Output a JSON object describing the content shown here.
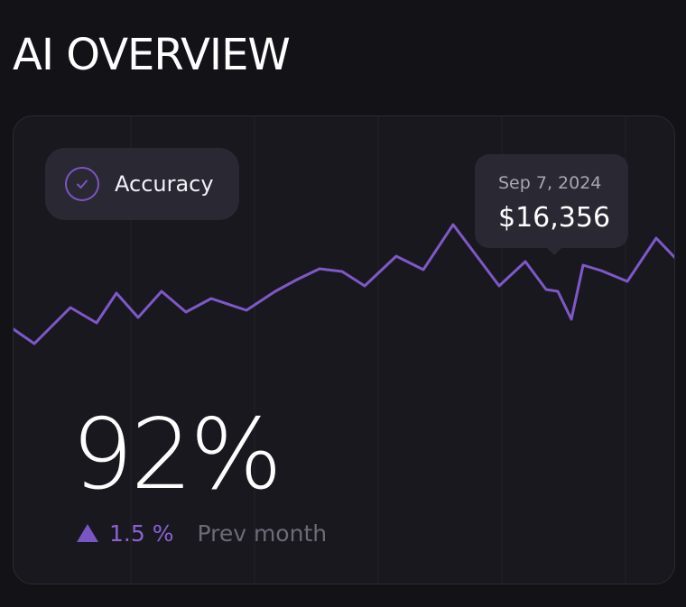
{
  "header": {
    "title": "AI OVERVIEW"
  },
  "card": {
    "metric_label": "Accuracy",
    "metric_icon": "check-circle-icon",
    "tooltip": {
      "date": "Sep 7, 2024",
      "value": "$16,356"
    },
    "big_value": "92%",
    "change": {
      "icon": "triangle-up-icon",
      "value": "1.5 %",
      "caption": "Prev month"
    }
  },
  "colors": {
    "background": "#131217",
    "card": "#19181e",
    "pill": "#2a2833",
    "accent": "#7a55c4",
    "text": "#ffffff",
    "muted": "#6d6a78"
  }
}
